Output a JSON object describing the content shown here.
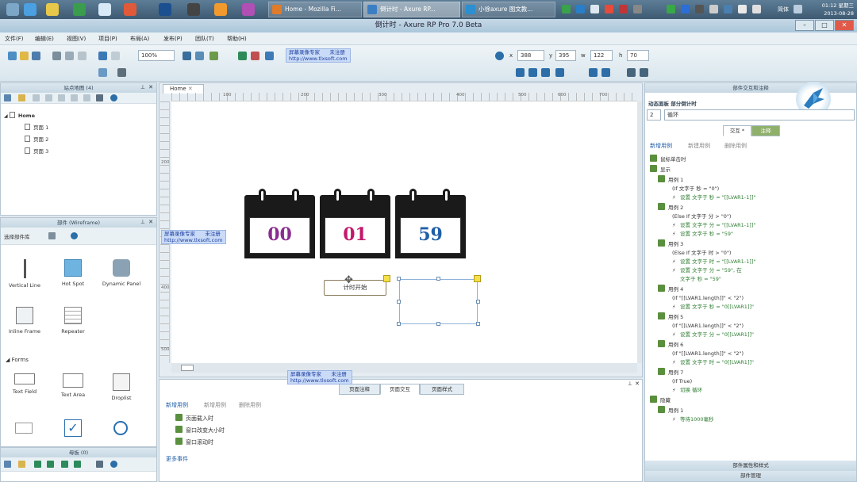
{
  "taskbar": {
    "tasks": [
      {
        "label": "Home - Mozilla Fi...",
        "color": "#e07b2a",
        "active": false
      },
      {
        "label": "倒计时 - Axure RP...",
        "color": "#3c7ec4",
        "active": true
      },
      {
        "label": "小徐axure 图文教...",
        "color": "#2b8fd1",
        "active": false
      }
    ],
    "clock": {
      "lang": "简体",
      "time": "01:12 星期三",
      "date": "2013-08-28"
    }
  },
  "window": {
    "title": "倒计时 - Axure RP Pro 7.0 Beta"
  },
  "menu": [
    "文件(F)",
    "编辑(E)",
    "视图(V)",
    "项目(P)",
    "布局(A)",
    "发布(P)",
    "团队(T)",
    "帮助(H)"
  ],
  "toolbar": {
    "zoom": "100%",
    "x_label": "x",
    "x_value": "388",
    "y_label": "y",
    "y_value": "395",
    "w_label": "w",
    "w_value": "122",
    "h_label": "h",
    "h_value": "70"
  },
  "watermark": {
    "line1": "屏幕录像专家      未注册",
    "line2": "http://www.tlxsoft.com"
  },
  "sitemap": {
    "title": "站点地图 (4)",
    "root": "Home",
    "pages": [
      "页面 1",
      "页面 2",
      "页面 3"
    ]
  },
  "widgets": {
    "title": "部件 (Wireframe)",
    "library": "选择部件库",
    "items": [
      {
        "label": "Vertical Line",
        "icon": "vertical-line-icon"
      },
      {
        "label": "Hot Spot",
        "icon": "hot-spot-icon"
      },
      {
        "label": "Dynamic Panel",
        "icon": "dynamic-panel-icon"
      },
      {
        "label": "Inline Frame",
        "icon": "inline-frame-icon"
      },
      {
        "label": "Repeater",
        "icon": "repeater-icon"
      }
    ],
    "forms_heading": "Forms",
    "forms": [
      {
        "label": "Text Field",
        "icon": "text-field-icon"
      },
      {
        "label": "Text Area",
        "icon": "text-area-icon"
      },
      {
        "label": "Droplist",
        "icon": "droplist-icon"
      }
    ]
  },
  "masters": {
    "title": "母板 (0)"
  },
  "canvas": {
    "tab": "Home",
    "ruler_h": [
      "100",
      "200",
      "300",
      "400",
      "500",
      "600",
      "700"
    ],
    "ruler_v": [
      "200",
      "300",
      "400",
      "500"
    ],
    "calendars": [
      {
        "value": "00",
        "color": "#8a2d8f"
      },
      {
        "value": "01",
        "color": "#c2186b"
      },
      {
        "value": "59",
        "color": "#1f5fa8"
      }
    ],
    "start_button": "计时开始"
  },
  "page_props": {
    "tabs": [
      "页面注释",
      "页面交互",
      "页面样式"
    ],
    "links": [
      "新增用例",
      "新增用例",
      "删除用例"
    ],
    "events": [
      "页面载入时",
      "窗口改变大小时",
      "窗口滚动时"
    ],
    "more": "更多事件"
  },
  "interactions": {
    "title": "部件交互和注释",
    "panel_label": "动态面板 部分倒计时",
    "id_value": "2",
    "name_value": "循环",
    "tabs": [
      "交互 *",
      "注释"
    ],
    "links": [
      "新增用例",
      "新建用例",
      "删除用例"
    ],
    "lines": [
      {
        "indent": 6,
        "kind": "event",
        "text": "鼠标单击时"
      },
      {
        "indent": 6,
        "kind": "event",
        "text": "显示"
      },
      {
        "indent": 16,
        "kind": "case",
        "text": "用例 1"
      },
      {
        "indent": 34,
        "kind": "cond",
        "text": "(If 文字于 秒 = \"0\")"
      },
      {
        "indent": 34,
        "kind": "action",
        "text": "设置 文字于 秒 = \"[[LVAR1-1]]\""
      },
      {
        "indent": 16,
        "kind": "case",
        "text": "用例 2"
      },
      {
        "indent": 34,
        "kind": "cond",
        "text": "(Else If 文字于 分 > \"0\")"
      },
      {
        "indent": 34,
        "kind": "action",
        "text": "设置 文字于 分 = \"[[LVAR1-1]]\""
      },
      {
        "indent": 34,
        "kind": "action",
        "text": "设置 文字于 秒 = \"59\""
      },
      {
        "indent": 16,
        "kind": "case",
        "text": "用例 3"
      },
      {
        "indent": 34,
        "kind": "cond",
        "text": "(Else If 文字于 时 > \"0\")"
      },
      {
        "indent": 34,
        "kind": "action",
        "text": "设置 文字于 时 = \"[[LVAR1-1]]\""
      },
      {
        "indent": 34,
        "kind": "action",
        "text": "设置 文字于 分 = \"59\", 在"
      },
      {
        "indent": 44,
        "kind": "cont",
        "text": "文字于 秒 = \"59\""
      },
      {
        "indent": 16,
        "kind": "case",
        "text": "用例 4"
      },
      {
        "indent": 34,
        "kind": "cond",
        "text": "(If \"[[LVAR1.length]]\" < \"2\")"
      },
      {
        "indent": 34,
        "kind": "action",
        "text": "设置 文字于 秒 = \"0[[LVAR1]]\""
      },
      {
        "indent": 16,
        "kind": "case",
        "text": "用例 5"
      },
      {
        "indent": 34,
        "kind": "cond",
        "text": "(If \"[[LVAR1.length]]\" < \"2\")"
      },
      {
        "indent": 34,
        "kind": "action",
        "text": "设置 文字于 分 = \"0[[LVAR1]]\""
      },
      {
        "indent": 16,
        "kind": "case",
        "text": "用例 6"
      },
      {
        "indent": 34,
        "kind": "cond",
        "text": "(If \"[[LVAR1.length]]\" < \"2\")"
      },
      {
        "indent": 34,
        "kind": "action",
        "text": "设置 文字于 时 = \"0[[LVAR1]]\""
      },
      {
        "indent": 16,
        "kind": "case",
        "text": "用例 7"
      },
      {
        "indent": 34,
        "kind": "cond",
        "text": "(If True)"
      },
      {
        "indent": 34,
        "kind": "action",
        "text": "切换 循环"
      },
      {
        "indent": 6,
        "kind": "event",
        "text": "隐藏"
      },
      {
        "indent": 16,
        "kind": "case",
        "text": "用例 1"
      },
      {
        "indent": 34,
        "kind": "action",
        "text": "等待1000毫秒"
      }
    ],
    "footer1": "部件属性和样式",
    "footer2": "部件管理"
  }
}
